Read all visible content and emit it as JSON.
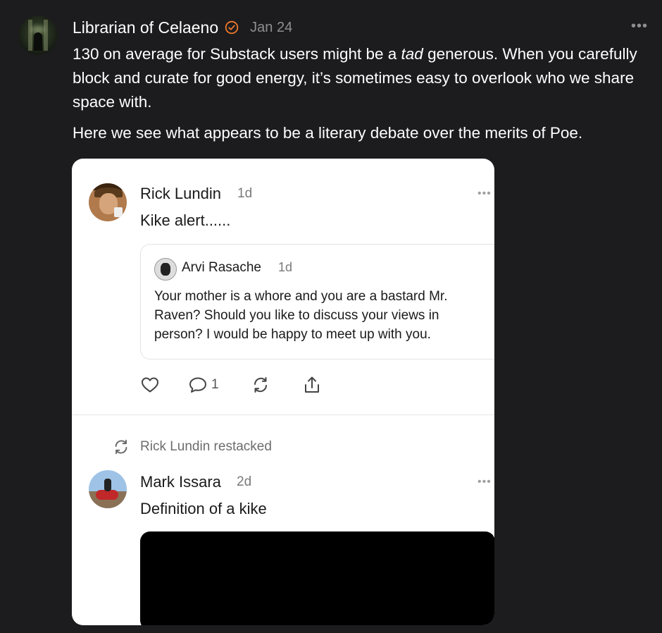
{
  "post": {
    "author": "Librarian of Celaeno",
    "date": "Jan 24",
    "more": "•••",
    "paragraph1_a": "130 on average for Substack users might be a ",
    "paragraph1_em": "tad",
    "paragraph1_b": " generous. When you carefully block and curate for good energy, it’s sometimes easy to overlook who we share space with.",
    "paragraph2": "Here we see what appears to be a literary debate over the merits of Poe.",
    "accent_color": "#f07a2a"
  },
  "embed": {
    "note1": {
      "author": "Rick Lundin",
      "time": "1d",
      "more": "•••",
      "text": "Kike alert......",
      "quote": {
        "author": "Arvi Rasache",
        "time": "1d",
        "text": "Your mother is a whore and you are a bastard Mr. Raven? Should you like to discuss your views in person? I would be happy to meet up with you."
      },
      "actions": {
        "like_icon": "heart-icon",
        "comment_icon": "comment-icon",
        "comment_count": "1",
        "restack_icon": "restack-icon",
        "share_icon": "share-icon"
      }
    },
    "restack": {
      "label": "Rick Lundin restacked",
      "icon": "restack-icon"
    },
    "note2": {
      "author": "Mark Issara",
      "time": "2d",
      "more": "•••",
      "text": "Definition of a kike"
    }
  }
}
